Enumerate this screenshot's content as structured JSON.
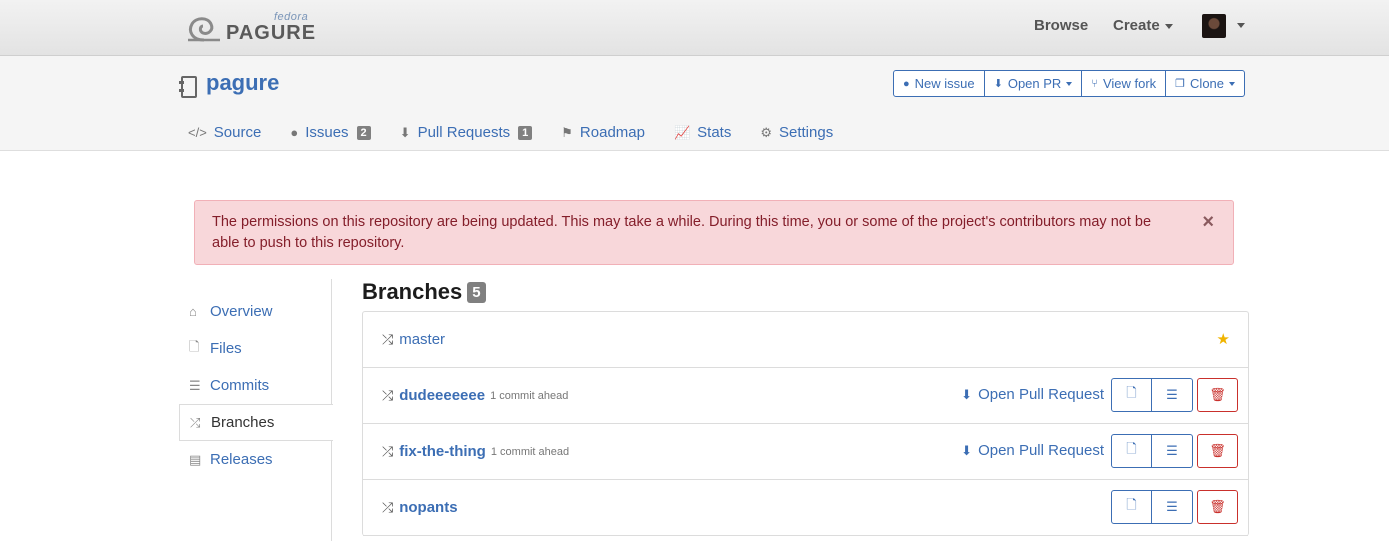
{
  "navbar": {
    "logo_small": "fedora",
    "logo_big": "PAGURE",
    "browse_label": "Browse",
    "create_label": "Create"
  },
  "repo": {
    "name": "pagure",
    "buttons": {
      "new_issue": "New issue",
      "open_pr": "Open PR",
      "view_fork": "View fork",
      "clone": "Clone"
    },
    "tabs": [
      {
        "label": "Source",
        "icon": "code-icon"
      },
      {
        "label": "Issues",
        "count": "2",
        "icon": "exclamation-circle-icon"
      },
      {
        "label": "Pull Requests",
        "count": "1",
        "icon": "arrow-circle-down-icon"
      },
      {
        "label": "Roadmap",
        "icon": "signpost-icon"
      },
      {
        "label": "Stats",
        "icon": "line-chart-icon"
      },
      {
        "label": "Settings",
        "icon": "gears-icon"
      }
    ]
  },
  "alert": {
    "message": "The permissions on this repository are being updated. This may take a while. During this time, you or some of the project's contributors may not be able to push to this repository.",
    "close": "×"
  },
  "sidebar": {
    "items": [
      {
        "label": "Overview",
        "icon": "home-icon"
      },
      {
        "label": "Files",
        "icon": "file-code-icon"
      },
      {
        "label": "Commits",
        "icon": "list-icon"
      },
      {
        "label": "Branches",
        "icon": "random-icon",
        "active": true
      },
      {
        "label": "Releases",
        "icon": "archive-icon"
      }
    ]
  },
  "branches": {
    "title": "Branches",
    "count": "5",
    "open_pr_label": "Open Pull Request",
    "rows": [
      {
        "name": "master",
        "ahead": "",
        "default": true
      },
      {
        "name": "dudeeeeeee",
        "ahead": "1 commit ahead"
      },
      {
        "name": "fix-the-thing",
        "ahead": "1 commit ahead"
      },
      {
        "name": "nopants",
        "ahead": ""
      }
    ]
  },
  "colors": {
    "link": "#3c6eb4",
    "danger": "#c9302c",
    "alert_bg": "#f8d7da",
    "star": "#f0b400"
  }
}
